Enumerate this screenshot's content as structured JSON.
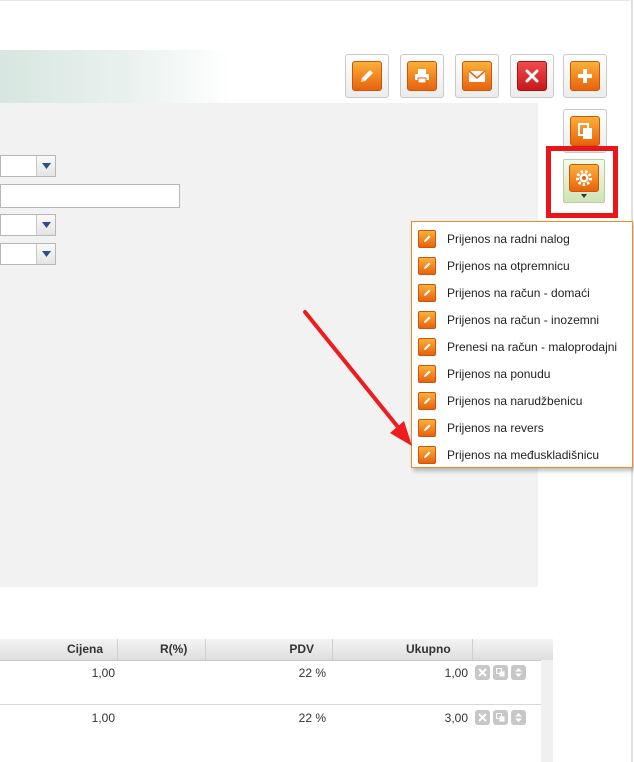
{
  "toolbar": {
    "buttons": [
      {
        "name": "edit",
        "icon": "pencil-icon"
      },
      {
        "name": "print",
        "icon": "printer-icon"
      },
      {
        "name": "email",
        "icon": "envelope-icon"
      },
      {
        "name": "delete",
        "icon": "x-icon"
      },
      {
        "name": "add",
        "icon": "plus-icon"
      }
    ],
    "copy_icon": "copy-icon",
    "settings_icon": "gear-icon"
  },
  "form": {
    "fields": [
      {
        "type": "select",
        "value": ""
      },
      {
        "type": "text",
        "value": ""
      },
      {
        "type": "select",
        "value": ""
      },
      {
        "type": "select",
        "value": ""
      }
    ]
  },
  "menu": {
    "items": [
      {
        "label": "Prijenos na radni nalog"
      },
      {
        "label": "Prijenos na otpremnicu"
      },
      {
        "label": "Prijenos na račun - domaći"
      },
      {
        "label": "Prijenos na račun - inozemni"
      },
      {
        "label": "Prenesi na račun - maloprodajni"
      },
      {
        "label": "Prijenos na ponudu"
      },
      {
        "label": "Prijenos na narudžbenicu"
      },
      {
        "label": "Prijenos na revers"
      },
      {
        "label": "Prijenos na međuskladišnicu"
      }
    ]
  },
  "grid": {
    "columns": [
      "Cijena",
      "R(%)",
      "PDV",
      "Ukupno"
    ],
    "rows": [
      {
        "cijena": "1,00",
        "rabat": "",
        "pdv": "22 %",
        "ukupno": "1,00"
      },
      {
        "cijena": "1,00",
        "rabat": "",
        "pdv": "22 %",
        "ukupno": "3,00"
      }
    ]
  },
  "colors": {
    "accent_orange": "#f08a1e",
    "highlight_red": "#e8151a",
    "delete_red": "#d01f22"
  }
}
